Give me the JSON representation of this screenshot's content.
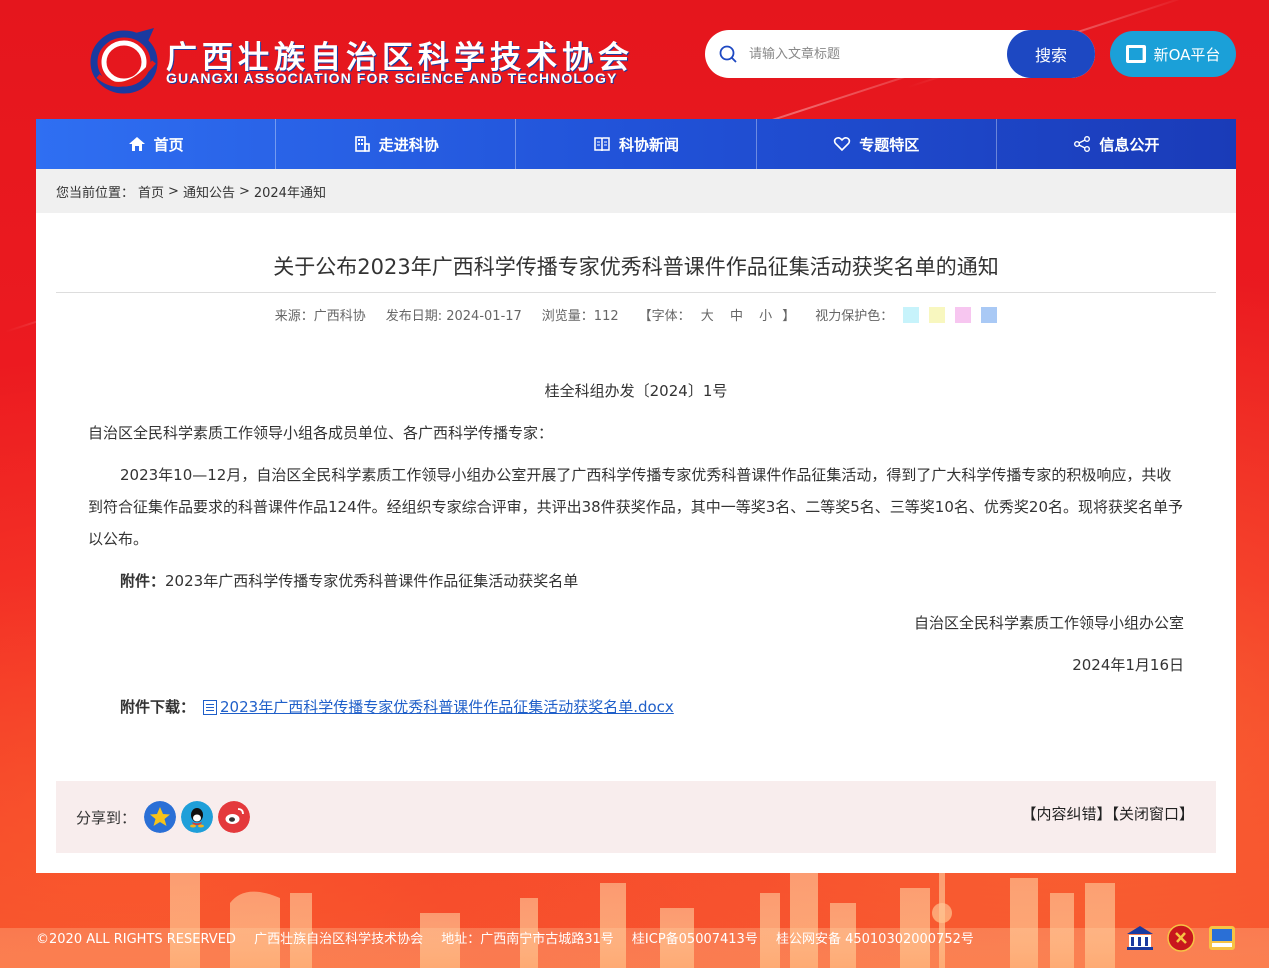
{
  "header": {
    "logo_cn": "广西壮族自治区科学技术协会",
    "logo_en": "GUANGXI ASSOCIATION FOR SCIENCE AND TECHNOLOGY",
    "search_placeholder": "请输入文章标题",
    "search_button": "搜索",
    "oa_button": "新OA平台"
  },
  "nav": {
    "items": [
      {
        "label": "首页",
        "icon": "home-icon"
      },
      {
        "label": "走进科协",
        "icon": "building-icon"
      },
      {
        "label": "科协新闻",
        "icon": "book-icon"
      },
      {
        "label": "专题特区",
        "icon": "heart-icon"
      },
      {
        "label": "信息公开",
        "icon": "share-nodes-icon"
      }
    ]
  },
  "breadcrumb": {
    "prefix": "您当前位置：",
    "items": [
      "首页",
      "通知公告",
      "2024年通知"
    ],
    "sep": ">"
  },
  "article": {
    "title": "关于公布2023年广西科学传播专家优秀科普课件作品征集活动获奖名单的通知",
    "meta": {
      "source": "来源：广西科协",
      "date": "发布日期: 2024-01-17",
      "views": "浏览量：112",
      "font_label": "【字体：",
      "font_large": "大",
      "font_medium": "中",
      "font_small": "小",
      "font_end": "】",
      "eye_label": "视力保护色："
    },
    "eye_colors": [
      "#c7f3fb",
      "#f8f7bf",
      "#f7c6f0",
      "#a9c9f5"
    ],
    "doc_no": "桂全科组办发〔2024〕1号",
    "addressee": "自治区全民科学素质工作领导小组各成员单位、各广西科学传播专家：",
    "paragraph": "2023年10—12月，自治区全民科学素质工作领导小组办公室开展了广西科学传播专家优秀科普课件作品征集活动，得到了广大科学传播专家的积极响应，共收到符合征集作品要求的科普课件作品124件。经组织专家综合评审，共评出38件获奖作品，其中一等奖3名、二等奖5名、三等奖10名、优秀奖20名。现将获奖名单予以公布。",
    "attachment_label": "附件：",
    "attachment_text": "2023年广西科学传播专家优秀科普课件作品征集活动获奖名单",
    "signature": "自治区全民科学素质工作领导小组办公室",
    "sign_date": "2024年1月16日",
    "download_label": "附件下载：",
    "download_link": "2023年广西科学传播专家优秀科普课件作品征集活动获奖名单.docx"
  },
  "share": {
    "label": "分享到：",
    "correct": "【内容纠错】",
    "close": "【关闭窗口】",
    "colors": {
      "qzone": "#2a6fd6",
      "qq": "#1f9fd9",
      "weibo": "#e4393c"
    }
  },
  "footer": {
    "copyright": "©2020 ALL RIGHTS RESERVED",
    "org": "广西壮族自治区科学技术协会",
    "address": "地址：广西南宁市古城路31号",
    "icp": "桂ICP备05007413号",
    "police": "桂公网安备 45010302000752号"
  }
}
